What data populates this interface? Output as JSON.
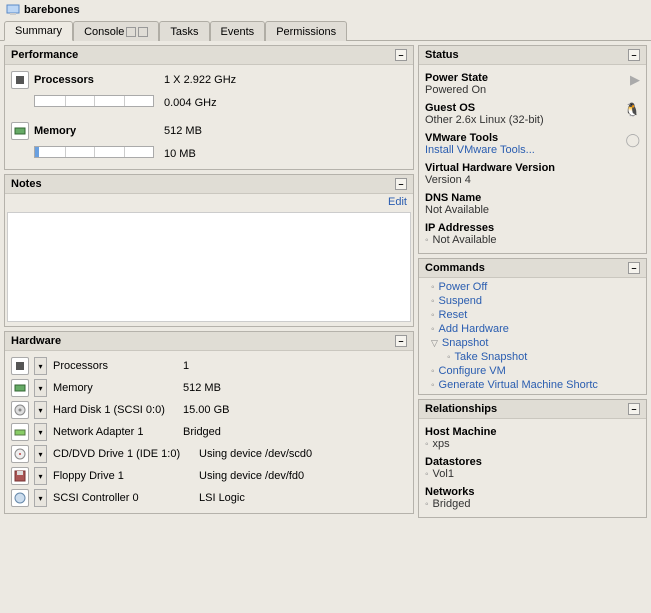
{
  "titlebar": {
    "name": "barebones"
  },
  "tabs": {
    "summary": "Summary",
    "console": "Console",
    "tasks": "Tasks",
    "events": "Events",
    "permissions": "Permissions"
  },
  "performance": {
    "heading": "Performance",
    "proc_label": "Processors",
    "proc_value": "1 X 2.922 GHz",
    "proc_usage": "0.004 GHz",
    "mem_label": "Memory",
    "mem_value": "512 MB",
    "mem_usage": "10 MB"
  },
  "notes": {
    "heading": "Notes",
    "edit": "Edit"
  },
  "hardware": {
    "heading": "Hardware",
    "rows": [
      {
        "label": "Processors",
        "value": "1"
      },
      {
        "label": "Memory",
        "value": "512 MB"
      },
      {
        "label": "Hard Disk 1 (SCSI 0:0)",
        "value": "15.00 GB"
      },
      {
        "label": "Network Adapter 1",
        "value": "Bridged"
      },
      {
        "label": "CD/DVD Drive 1 (IDE 1:0)",
        "value": "Using device /dev/scd0"
      },
      {
        "label": "Floppy Drive 1",
        "value": "Using device /dev/fd0"
      },
      {
        "label": "SCSI Controller 0",
        "value": "LSI Logic"
      }
    ]
  },
  "status": {
    "heading": "Status",
    "power_label": "Power State",
    "power_value": "Powered On",
    "guest_label": "Guest OS",
    "guest_value": "Other 2.6x Linux (32-bit)",
    "tools_label": "VMware Tools",
    "tools_link": "Install VMware Tools...",
    "vhw_label": "Virtual Hardware Version",
    "vhw_value": "Version 4",
    "dns_label": "DNS Name",
    "dns_value": "Not Available",
    "ip_label": "IP Addresses",
    "ip_value": "Not Available"
  },
  "commands": {
    "heading": "Commands",
    "items": {
      "power_off": "Power Off",
      "suspend": "Suspend",
      "reset": "Reset",
      "add_hw": "Add Hardware",
      "snapshot": "Snapshot",
      "take_snapshot": "Take Snapshot",
      "configure": "Configure VM",
      "gen_shortcut": "Generate Virtual Machine Shortc"
    }
  },
  "relationships": {
    "heading": "Relationships",
    "host_label": "Host Machine",
    "host_value": "xps",
    "ds_label": "Datastores",
    "ds_value": "Vol1",
    "net_label": "Networks",
    "net_value": "Bridged"
  },
  "collapse_glyph": "–"
}
